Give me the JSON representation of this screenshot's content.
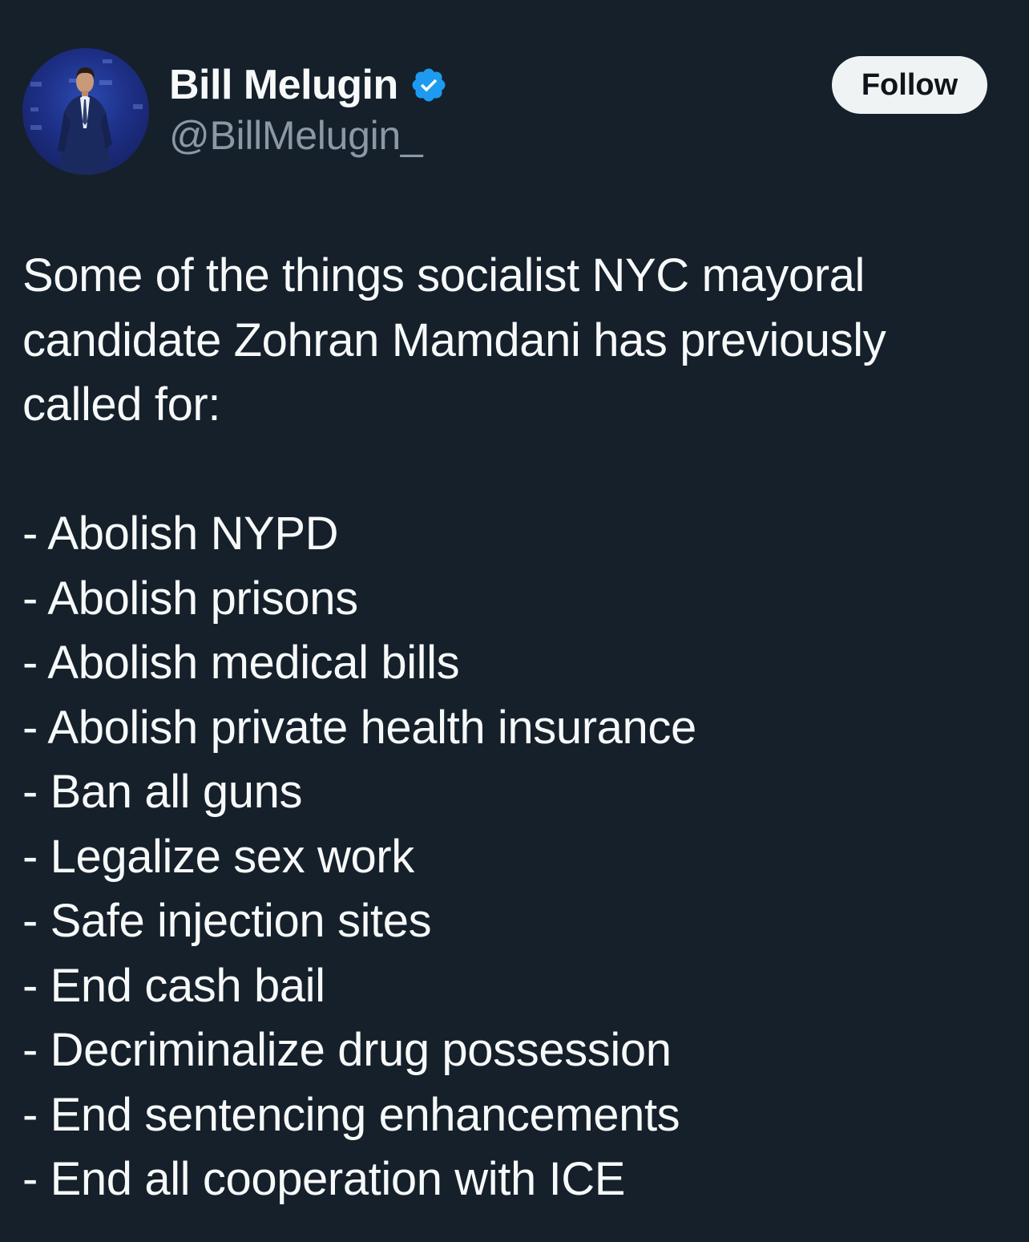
{
  "author": {
    "display_name": "Bill Melugin",
    "handle": "@BillMelugin_",
    "verified": true,
    "avatar_icon": "avatar-photo",
    "verified_color": "#1d9bf0"
  },
  "actions": {
    "follow_label": "Follow"
  },
  "tweet": {
    "intro": "Some of the things socialist NYC mayoral candidate Zohran Mamdani has previously called for:",
    "items": [
      "- Abolish NYPD",
      "- Abolish prisons",
      "- Abolish medical bills",
      "- Abolish private health insurance",
      "- Ban all guns",
      "- Legalize sex work",
      "- Safe injection sites",
      "- End cash bail",
      "- Decriminalize drug possession",
      "- End sentencing enhancements",
      "- End all cooperation with ICE"
    ]
  },
  "colors": {
    "background": "#15202b",
    "text": "#f7f9f9",
    "secondary_text": "#8b98a5",
    "follow_bg": "#eff3f4"
  }
}
